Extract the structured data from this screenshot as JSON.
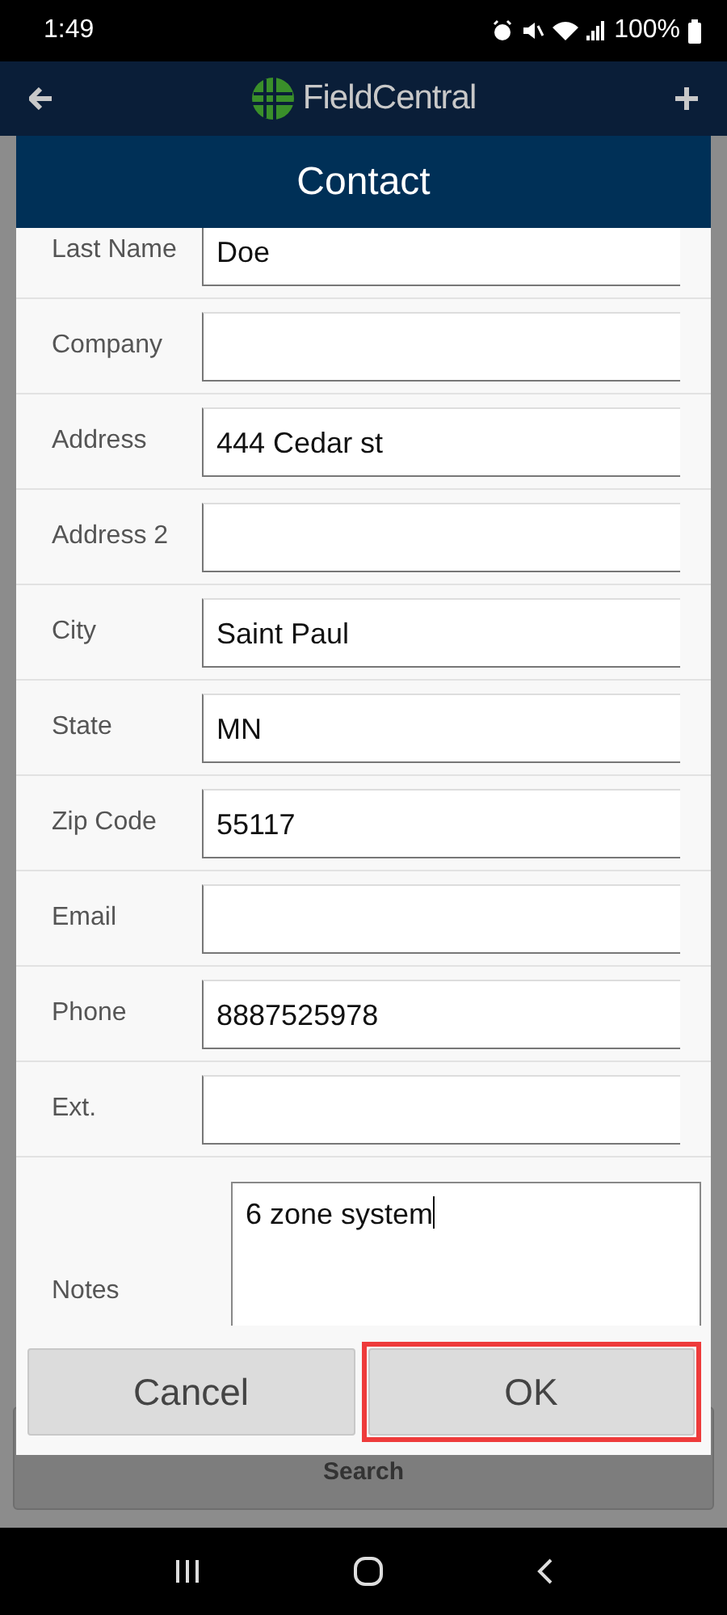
{
  "status_bar": {
    "time": "1:49",
    "battery": "100%"
  },
  "header": {
    "logo_text": "FieldCentral"
  },
  "dialog": {
    "title": "Contact",
    "fields": [
      {
        "kind": "line",
        "label": "Last Name",
        "value": "Doe"
      },
      {
        "kind": "line",
        "label": "Company"
      },
      {
        "kind": "line",
        "label": "Address",
        "value": "444 Cedar st"
      },
      {
        "kind": "line",
        "label": "Address 2"
      },
      {
        "kind": "line",
        "label": "City",
        "value": "Saint Paul"
      },
      {
        "kind": "line",
        "label": "State",
        "value": "MN"
      },
      {
        "kind": "line",
        "label": "Zip Code",
        "value": "55117"
      },
      {
        "kind": "line",
        "label": "Email"
      },
      {
        "kind": "line",
        "label": "Phone",
        "value": "8887525978"
      },
      {
        "kind": "line",
        "label": "Ext."
      },
      {
        "kind": "area",
        "label": "Notes",
        "value": "6 zone system"
      }
    ],
    "buttons": [
      {
        "label": "Cancel",
        "highlighted": false
      },
      {
        "label": "OK",
        "highlighted": true
      }
    ]
  },
  "background_button": {
    "label": "Search"
  }
}
